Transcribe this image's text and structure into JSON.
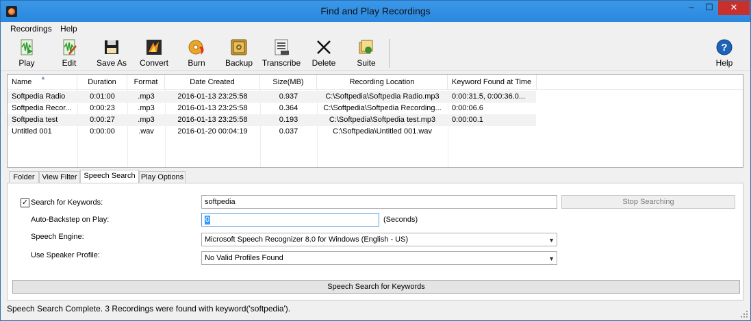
{
  "window": {
    "title": "Find and Play Recordings"
  },
  "controls": {
    "minimize": "–",
    "maximize": "☐",
    "close": "✕"
  },
  "menu": [
    "Recordings",
    "Help"
  ],
  "toolbar": {
    "play": "Play",
    "edit": "Edit",
    "save_as": "Save As",
    "convert": "Convert",
    "burn": "Burn",
    "backup": "Backup",
    "transcribe": "Transcribe",
    "delete": "Delete",
    "suite": "Suite",
    "help": "Help"
  },
  "icons": {
    "play": "play-wave-icon",
    "edit": "edit-wave-icon",
    "save_as": "floppy-disk-icon",
    "convert": "convert-icon",
    "burn": "disc-burn-icon",
    "backup": "backup-safe-icon",
    "transcribe": "transcribe-icon",
    "delete": "delete-x-icon",
    "suite": "suite-icon",
    "help": "help-icon"
  },
  "table": {
    "headers": [
      "Name",
      "Duration",
      "Format",
      "Date Created",
      "Size(MB)",
      "Recording Location",
      "Keyword Found at Time"
    ],
    "rows": [
      [
        "Softpedia Radio",
        "0:01:00",
        ".mp3",
        "2016-01-13 23:25:58",
        "0.937",
        "C:\\Softpedia\\Softpedia Radio.mp3",
        "0:00:31.5, 0:00:36.0..."
      ],
      [
        "Softpedia Recor...",
        "0:00:23",
        ".mp3",
        "2016-01-13 23:25:58",
        "0.364",
        "C:\\Softpedia\\Softpedia Recording...",
        "0:00:06.6"
      ],
      [
        "Softpedia test",
        "0:00:27",
        ".mp3",
        "2016-01-13 23:25:58",
        "0.193",
        "C:\\Softpedia\\Softpedia test.mp3",
        "0:00:00.1"
      ],
      [
        "Untitled 001",
        "0:00:00",
        ".wav",
        "2016-01-20 00:04:19",
        "0.037",
        "C:\\Softpedia\\Untitled 001.wav",
        ""
      ]
    ]
  },
  "tabs": [
    "Folder",
    "View Filter",
    "Speech Search",
    "Play Options"
  ],
  "active_tab": "Speech Search",
  "speech": {
    "search_keywords_label": "Search for Keywords:",
    "search_keywords_checked": true,
    "keyword_value": "softpedia",
    "stop_button": "Stop Searching",
    "backstep_label": "Auto-Backstep on Play:",
    "backstep_value": "0",
    "seconds_label": "(Seconds)",
    "engine_label": "Speech Engine:",
    "engine_value": "Microsoft Speech Recognizer 8.0 for Windows (English - US)",
    "profile_label": "Use Speaker Profile:",
    "profile_value": "No Valid Profiles Found",
    "search_button": "Speech Search for Keywords"
  },
  "status": "Speech Search Complete. 3 Recordings were found with keyword('softpedia')."
}
